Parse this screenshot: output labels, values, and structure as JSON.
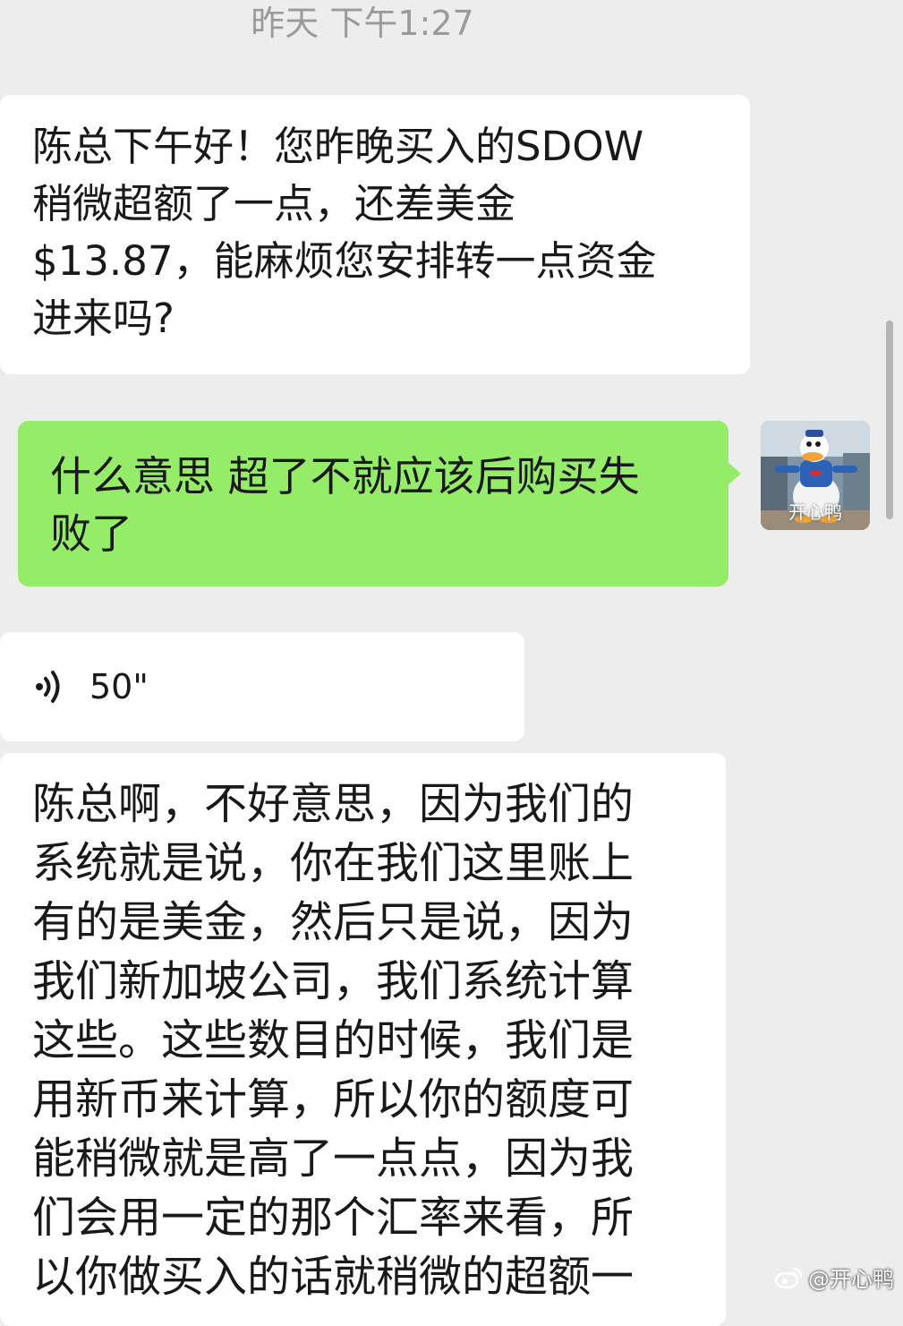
{
  "chat": {
    "timestamp": "昨天 下午1:27",
    "messages": [
      {
        "sender": "other",
        "type": "text",
        "text": "陈总下午好！您昨晚买入的SDOW\n稍微超额了一点，还差美金\n$13.87，能麻烦您安排转一点资金\n进来吗?"
      },
      {
        "sender": "self",
        "type": "text",
        "text": "什么意思 超了不就应该后购买失\n败了"
      },
      {
        "sender": "other",
        "type": "voice",
        "duration": "50\""
      },
      {
        "sender": "other",
        "type": "text",
        "text": "陈总啊，不好意思，因为我们的\n系统就是说，你在我们这里账上\n有的是美金，然后只是说，因为\n我们新加坡公司，我们系统计算\n这些。这些数目的时候，我们是\n用新币来计算，所以你的额度可\n能稍微就是高了一点点，因为我\n们会用一定的那个汇率来看，所\n以你做买入的话就稍微的超额一"
      }
    ],
    "self_avatar": {
      "icon": "donald-duck-avatar",
      "caption": "开心鸭"
    }
  },
  "watermark": {
    "icon": "weibo-icon",
    "text": "@开心鸭"
  },
  "colors": {
    "background": "#ededed",
    "incoming_bubble": "#ffffff",
    "outgoing_bubble": "#95ec69",
    "timestamp": "#9a9a9a"
  }
}
